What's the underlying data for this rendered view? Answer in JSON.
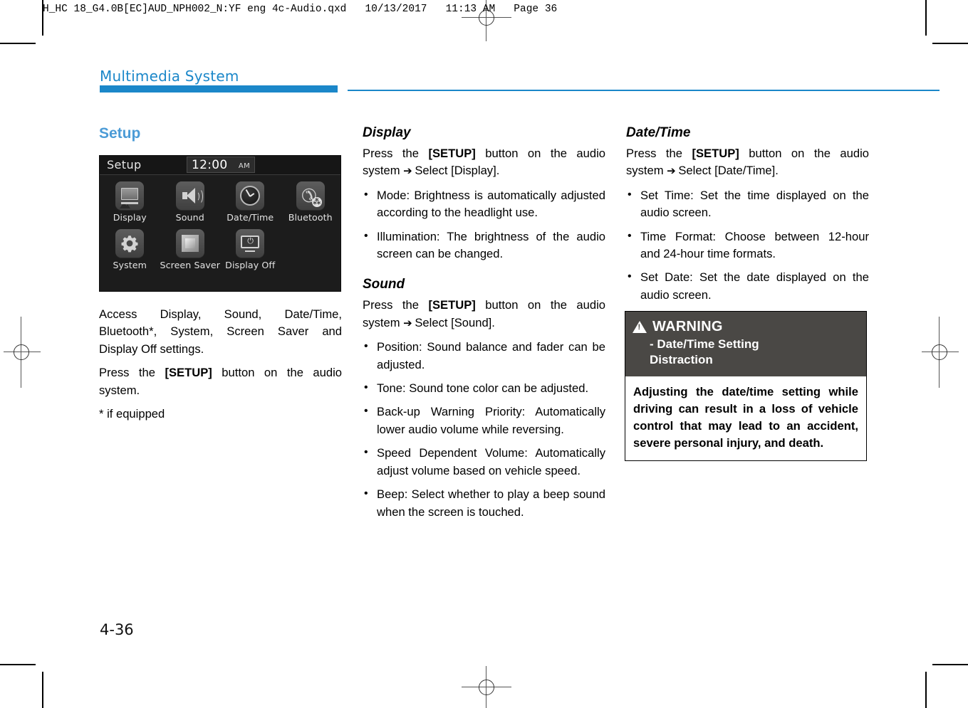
{
  "prepress": {
    "header_line": "H_HC 18_G4.0B[EC]AUD_NPH002_N:YF eng 4c-Audio.qxd   10/13/2017   11:13 AM   Page 36"
  },
  "running_head": {
    "title": "Multimedia System"
  },
  "folio": {
    "page_number": "4-36"
  },
  "colors": {
    "accent_blue": "#1b87c9",
    "heading_blue": "#4b9bd6",
    "warning_header_bg": "#4a4845"
  },
  "columns": {
    "left": {
      "heading": "Setup",
      "paragraphs": [
        "Access Display, Sound, Date/Time, Bluetooth*, System, Screen Saver and Display Off settings.",
        "* if equipped"
      ],
      "press_paragraph": {
        "before": "Press the ",
        "bold": "[SETUP]",
        "after": " button on the audio system."
      }
    },
    "middle": {
      "sections": [
        {
          "heading": "Display",
          "press": {
            "before": "Press the ",
            "bold": "[SETUP]",
            "after": " button on the audio system ",
            "arrow": "➔",
            "tail": " Select [Display]."
          },
          "bullets": [
            "Mode: Brightness is automatically adjusted according to the headlight use.",
            "Illumination: The brightness of the audio screen can be changed."
          ]
        },
        {
          "heading": "Sound",
          "press": {
            "before": "Press the ",
            "bold": "[SETUP]",
            "after": " button on the audio system ",
            "arrow": "➔",
            "tail": " Select [Sound]."
          },
          "bullets": [
            "Position: Sound balance and fader can be adjusted.",
            "Tone: Sound tone color can be adjusted.",
            "Back-up Warning Priority: Automatically lower audio volume while reversing.",
            "Speed Dependent Volume: Automatically adjust volume based on vehicle speed.",
            "Beep: Select whether to play a beep sound when the screen is touched."
          ]
        }
      ]
    },
    "right": {
      "sections": [
        {
          "heading": "Date/Time",
          "press": {
            "before": "Press the ",
            "bold": "[SETUP]",
            "after": " button on the audio system ",
            "arrow": "➔",
            "tail": " Select [Date/Time]."
          },
          "bullets": [
            "Set Time: Set the time displayed on the audio screen.",
            "Time Format: Choose between 12-hour and 24-hour time formats.",
            "Set Date: Set the date displayed on the audio screen."
          ]
        }
      ]
    }
  },
  "warning_box": {
    "icon": "warning-triangle-icon",
    "title": "WARNING",
    "subtitle_line1": "- Date/Time Setting",
    "subtitle_line2": "Distraction",
    "body": "Adjusting the date/time setting while driving can result in a loss of vehicle control that may lead to an accident, severe personal injury, and death."
  },
  "audio_screen": {
    "title": "Setup",
    "clock_time": "12:00",
    "clock_ampm": "AM",
    "tiles": [
      {
        "label": "Display",
        "icon": "picture-monitor-icon"
      },
      {
        "label": "Sound",
        "icon": "speaker-icon"
      },
      {
        "label": "Date/Time",
        "icon": "clock-icon"
      },
      {
        "label": "Bluetooth",
        "icon": "bluetooth-handset-icon"
      },
      {
        "label": "System",
        "icon": "gear-icon"
      },
      {
        "label": "Screen Saver",
        "icon": "square-frame-icon"
      },
      {
        "label": "Display Off",
        "icon": "monitor-power-icon"
      }
    ]
  }
}
